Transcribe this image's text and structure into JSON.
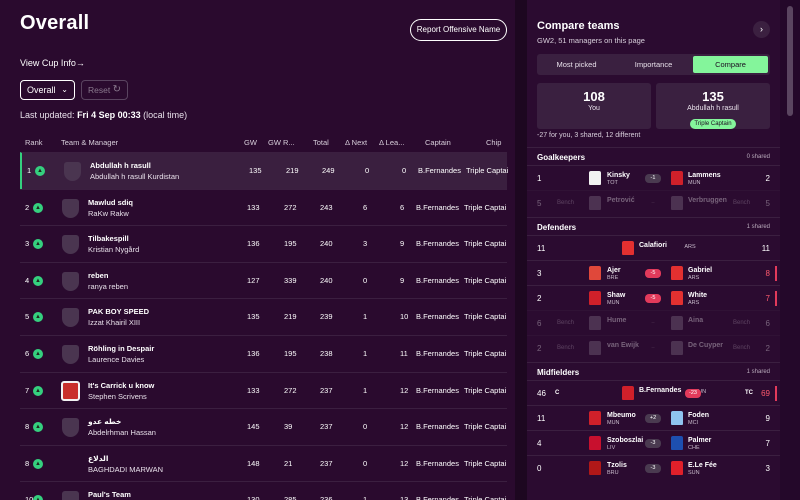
{
  "header": {
    "title": "Overall",
    "report_label": "Report Offensive Name",
    "cup_link": "View Cup Info",
    "cup_arrow": "→",
    "filter_value": "Overall",
    "reset_label": "Reset",
    "updated_prefix": "Last updated:",
    "updated_value": "Fri 4 Sep 00:33",
    "updated_suffix": "(local time)"
  },
  "table": {
    "columns": [
      "Rank",
      "Team & Manager",
      "GW",
      "GW R...",
      "Total",
      "Δ Next",
      "Δ Lea...",
      "Captain",
      "Chip"
    ],
    "rows": [
      {
        "rank": "1",
        "team": "Abdullah h rasull",
        "manager": "Abdullah h rasull Kurdistan",
        "gw": "135",
        "gwr": "219",
        "total": "249",
        "next": "0",
        "lead": "0",
        "captain": "B.Fernandes",
        "chip": "Triple Captai"
      },
      {
        "rank": "2",
        "team": "Mawlud sdiq",
        "manager": "RaKw Rakw",
        "gw": "133",
        "gwr": "272",
        "total": "243",
        "next": "6",
        "lead": "6",
        "captain": "B.Fernandes",
        "chip": "Triple Captai"
      },
      {
        "rank": "3",
        "team": "Tilbakespill",
        "manager": "Kristian Nygård",
        "gw": "136",
        "gwr": "195",
        "total": "240",
        "next": "3",
        "lead": "9",
        "captain": "B.Fernandes",
        "chip": "Triple Captai"
      },
      {
        "rank": "4",
        "team": "reben",
        "manager": "ranya reben",
        "gw": "127",
        "gwr": "339",
        "total": "240",
        "next": "0",
        "lead": "9",
        "captain": "B.Fernandes",
        "chip": "Triple Captai"
      },
      {
        "rank": "5",
        "team": "PAK BOY SPEED",
        "manager": "Izzat Khairil XIII",
        "gw": "135",
        "gwr": "219",
        "total": "239",
        "next": "1",
        "lead": "10",
        "captain": "B.Fernandes",
        "chip": "Triple Captai"
      },
      {
        "rank": "6",
        "team": "Röhling in Despair",
        "manager": "Laurence Davies",
        "gw": "136",
        "gwr": "195",
        "total": "238",
        "next": "1",
        "lead": "11",
        "captain": "B.Fernandes",
        "chip": "Triple Captai"
      },
      {
        "rank": "7",
        "team": "It's Carrick u know",
        "manager": "Stephen Scrivens",
        "gw": "133",
        "gwr": "272",
        "total": "237",
        "next": "1",
        "lead": "12",
        "captain": "B.Fernandes",
        "chip": "Triple Captai"
      },
      {
        "rank": "8",
        "team": "خطه عدو",
        "manager": "Abdelrhman Hassan",
        "gw": "145",
        "gwr": "39",
        "total": "237",
        "next": "0",
        "lead": "12",
        "captain": "B.Fernandes",
        "chip": "Triple Captai"
      },
      {
        "rank": "8",
        "team": "الدلاع",
        "manager": "BAGHDADI MARWAN",
        "gw": "148",
        "gwr": "21",
        "total": "237",
        "next": "0",
        "lead": "12",
        "captain": "B.Fernandes",
        "chip": "Triple Captai"
      },
      {
        "rank": "10",
        "team": "Paul's Team",
        "manager": "",
        "gw": "130",
        "gwr": "285",
        "total": "236",
        "next": "1",
        "lead": "13",
        "captain": "B.Fernandes",
        "chip": "Triple Captai"
      }
    ]
  },
  "compare": {
    "title": "Compare teams",
    "subtitle": "GW2, 51 managers on this page",
    "next_arrow": "›",
    "tabs": [
      "Most picked",
      "Importance",
      "Compare"
    ],
    "you_score": "108",
    "you_label": "You",
    "other_score": "135",
    "other_label": "Abdullah h rasull",
    "other_chip": "Triple Captain",
    "diff_text": "-27 for you, 3 shared, 12 different",
    "bench_label": "Bench",
    "sections": {
      "gk": {
        "name": "Goalkeepers",
        "shared": "0 shared"
      },
      "def": {
        "name": "Defenders",
        "shared": "1 shared"
      },
      "mid": {
        "name": "Midfielders",
        "shared": "1 shared"
      }
    },
    "gk_rows": [
      {
        "lp": "1",
        "lname": "Kinsky",
        "lteam": "TOT",
        "pts": "-1",
        "rname": "Lammens",
        "rteam": "MUN",
        "rp": "2"
      },
      {
        "lp": "5",
        "lname": "Petrović",
        "lteam": "",
        "pts": "",
        "rname": "Verbruggen",
        "rteam": "",
        "rp": "5"
      }
    ],
    "def_rows": [
      {
        "lp": "11",
        "cname": "Calafiori",
        "cteam": "ARS",
        "rp": "11"
      },
      {
        "lp": "3",
        "lname": "Ajer",
        "lteam": "BRE",
        "pts": "-5",
        "rname": "Gabriel",
        "rteam": "ARS",
        "rp": "8"
      },
      {
        "lp": "2",
        "lname": "Shaw",
        "lteam": "MUN",
        "pts": "-5",
        "rname": "White",
        "rteam": "ARS",
        "rp": "7"
      },
      {
        "lp": "6",
        "lname": "Hume",
        "lteam": "",
        "pts": "",
        "rname": "Aina",
        "rteam": "",
        "rp": "6"
      },
      {
        "lp": "2",
        "lname": "van Ewijk",
        "lteam": "",
        "pts": "",
        "rname": "De Cuyper",
        "rteam": "",
        "rp": "2"
      }
    ],
    "mid_rows": [
      {
        "lp": "46",
        "cap": "C",
        "cname": "B.Fernandes",
        "cteam": "MUN",
        "pts": "-23",
        "rcap": "TC",
        "rp": "69"
      },
      {
        "lp": "11",
        "lname": "Mbeumo",
        "lteam": "MUN",
        "pts": "+2",
        "rname": "Foden",
        "rteam": "MCI",
        "rp": "9"
      },
      {
        "lp": "4",
        "lname": "Szoboszlai",
        "lteam": "LIV",
        "pts": "-3",
        "rname": "Palmer",
        "rteam": "CHE",
        "rp": "7"
      },
      {
        "lp": "0",
        "lname": "Tzolis",
        "lteam": "BRU",
        "pts": "-3",
        "rname": "E.Le Fée",
        "rteam": "SUN",
        "rp": "3"
      }
    ]
  }
}
